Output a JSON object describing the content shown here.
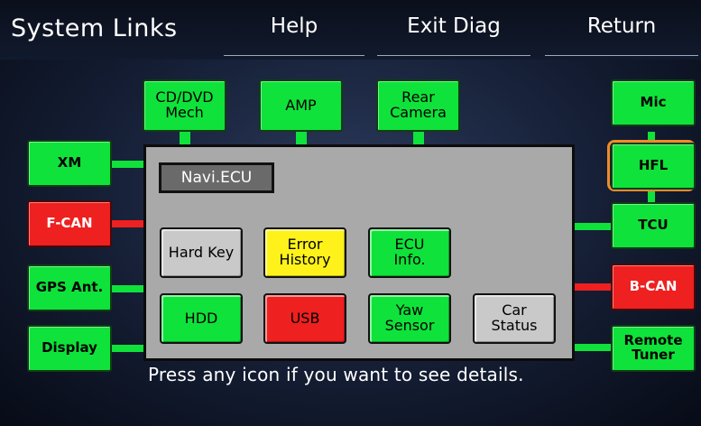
{
  "header": {
    "title": "System Links",
    "help_label": "Help",
    "exit_label": "Exit Diag",
    "return_label": "Return"
  },
  "top_modules": {
    "cd_dvd": "CD/DVD\nMech",
    "amp": "AMP",
    "rear_camera": "Rear\nCamera"
  },
  "left_modules": {
    "xm": "XM",
    "fcan": "F-CAN",
    "gps": "GPS Ant.",
    "display": "Display"
  },
  "right_modules": {
    "mic": "Mic",
    "hfl": "HFL",
    "tcu": "TCU",
    "bcan": "B-CAN",
    "remote_tuner": "Remote\nTuner"
  },
  "panel": {
    "title": "Navi.ECU",
    "hard_key": "Hard Key",
    "error_history": "Error\nHistory",
    "ecu_info": "ECU\nInfo.",
    "hdd": "HDD",
    "usb": "USB",
    "yaw_sensor": "Yaw\nSensor",
    "car_status": "Car\nStatus"
  },
  "hint": "Press any icon if you want to see details.",
  "colors": {
    "ok": "#0fe23a",
    "fault": "#ee2020",
    "warning": "#fff21a",
    "neutral": "#c9c9c9",
    "selected_ring": "#f08a2a"
  }
}
